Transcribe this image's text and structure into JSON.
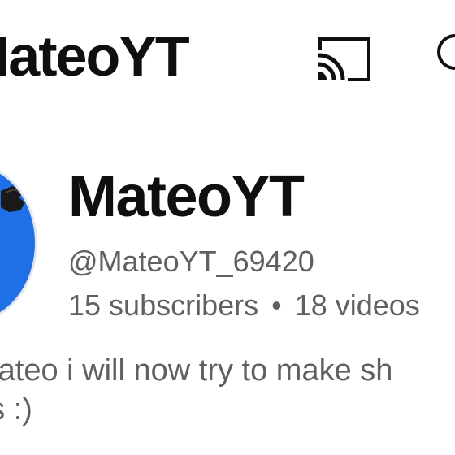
{
  "header": {
    "title": "MateoYT",
    "cast_icon": "cast-icon",
    "search_icon": "search-icon"
  },
  "channel": {
    "name": "MateoYT",
    "handle": "@MateoYT_69420",
    "subscribers": "15 subscribers",
    "separator": "•",
    "videos": "18 videos",
    "description_line1": "mateo i will now try to make sh",
    "description_line2": "ds :)",
    "avatar_color": "#1f6fe6"
  }
}
